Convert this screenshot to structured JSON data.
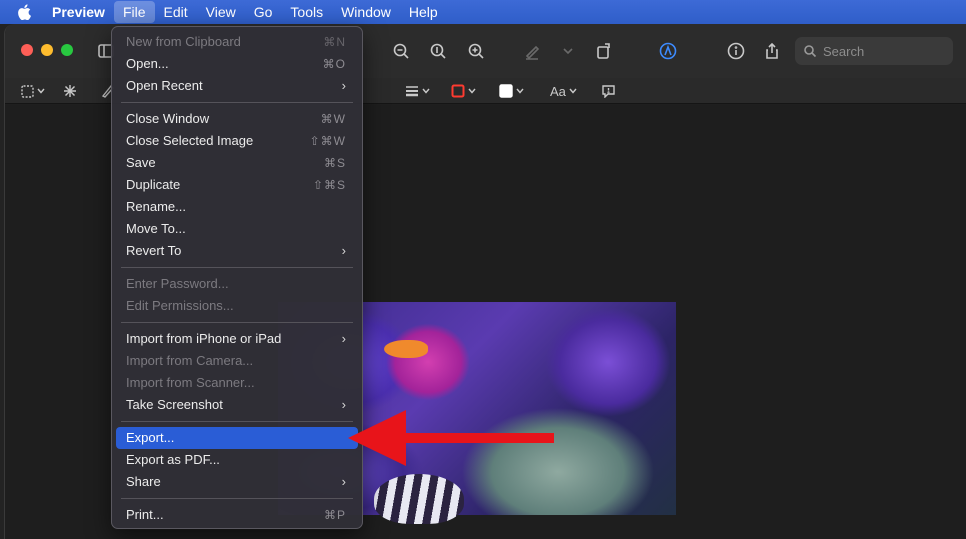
{
  "menubar": {
    "app": "Preview",
    "items": [
      "File",
      "Edit",
      "View",
      "Go",
      "Tools",
      "Window",
      "Help"
    ]
  },
  "search": {
    "placeholder": "Search"
  },
  "markup": {
    "text_style": "Aa"
  },
  "file_menu": {
    "items": [
      {
        "label": "New from Clipboard",
        "shortcut": "⌘N"
      },
      {
        "label": "Open...",
        "shortcut": "⌘O"
      },
      {
        "label": "Open Recent",
        "shortcut": "›"
      },
      {
        "label": "Close Window",
        "shortcut": "⌘W"
      },
      {
        "label": "Close Selected Image",
        "shortcut": "⇧⌘W"
      },
      {
        "label": "Save",
        "shortcut": "⌘S"
      },
      {
        "label": "Duplicate",
        "shortcut": "⇧⌘S"
      },
      {
        "label": "Rename..."
      },
      {
        "label": "Move To..."
      },
      {
        "label": "Revert To",
        "shortcut": "›"
      },
      {
        "label": "Enter Password..."
      },
      {
        "label": "Edit Permissions..."
      },
      {
        "label": "Import from iPhone or iPad",
        "shortcut": "›"
      },
      {
        "label": "Import from Camera..."
      },
      {
        "label": "Import from Scanner..."
      },
      {
        "label": "Take Screenshot",
        "shortcut": "›"
      },
      {
        "label": "Export..."
      },
      {
        "label": "Export as PDF..."
      },
      {
        "label": "Share",
        "shortcut": "›"
      },
      {
        "label": "Print...",
        "shortcut": "⌘P"
      }
    ]
  },
  "colors": {
    "menubar": "#2f5ec9",
    "highlight": "#2a5dd6",
    "annotation_arrow": "#e8141a"
  }
}
